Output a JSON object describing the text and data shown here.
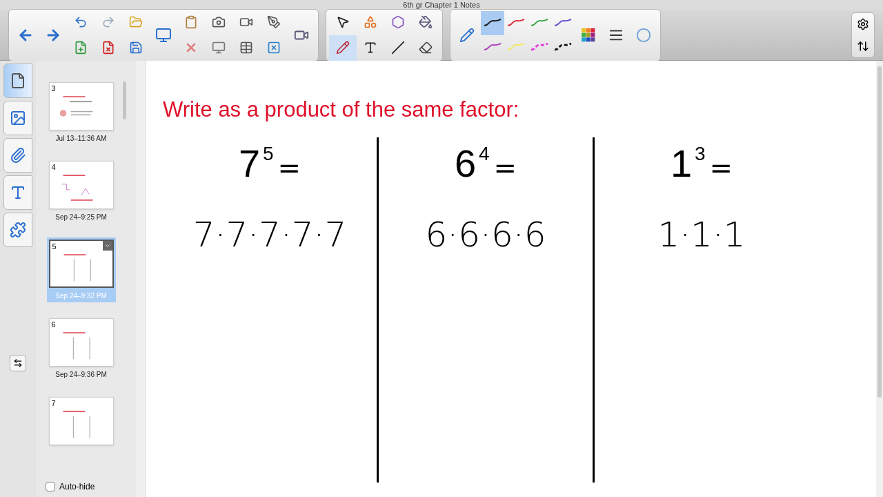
{
  "window": {
    "title": "6th gr Chapter 1 Notes"
  },
  "pens": [
    {
      "color": "#1a1a1a",
      "selected": true,
      "dashed": false
    },
    {
      "color": "#e0303a",
      "selected": false,
      "dashed": false
    },
    {
      "color": "#3aa84a",
      "selected": false,
      "dashed": false
    },
    {
      "color": "#6a4fd0",
      "selected": false,
      "dashed": false
    },
    {
      "color": "#b040c0",
      "selected": false,
      "dashed": false
    },
    {
      "color": "#f0ea60",
      "selected": false,
      "dashed": false
    },
    {
      "color": "#e040e0",
      "selected": false,
      "dashed": true
    },
    {
      "color": "#1a1a1a",
      "selected": false,
      "dashed": true
    }
  ],
  "side_tabs": [
    {
      "kind": "pages",
      "selected": true
    },
    {
      "kind": "gallery",
      "selected": false
    },
    {
      "kind": "attachments",
      "selected": false
    },
    {
      "kind": "properties",
      "selected": false
    },
    {
      "kind": "addons",
      "selected": false
    }
  ],
  "slides": [
    {
      "number": "3",
      "date": "Jul 13–11:36 AM",
      "selected": false
    },
    {
      "number": "4",
      "date": "Sep 24–9:25 PM",
      "selected": false
    },
    {
      "number": "5",
      "date": "Sep 24–9:32 PM",
      "selected": true
    },
    {
      "number": "6",
      "date": "Sep 24–9:36 PM",
      "selected": false
    },
    {
      "number": "7",
      "selected": false
    }
  ],
  "auto_hide": {
    "label": "Auto-hide",
    "checked": false
  },
  "page": {
    "heading": "Write as a product of the same factor:",
    "columns": [
      {
        "base": "7",
        "exponent": "5",
        "equals": "=",
        "answer": "7·7·7·7·7"
      },
      {
        "base": "6",
        "exponent": "4",
        "equals": "=",
        "answer": "6·6·6·6"
      },
      {
        "base": "1",
        "exponent": "3",
        "equals": "=",
        "answer": "1·1·1"
      }
    ]
  }
}
